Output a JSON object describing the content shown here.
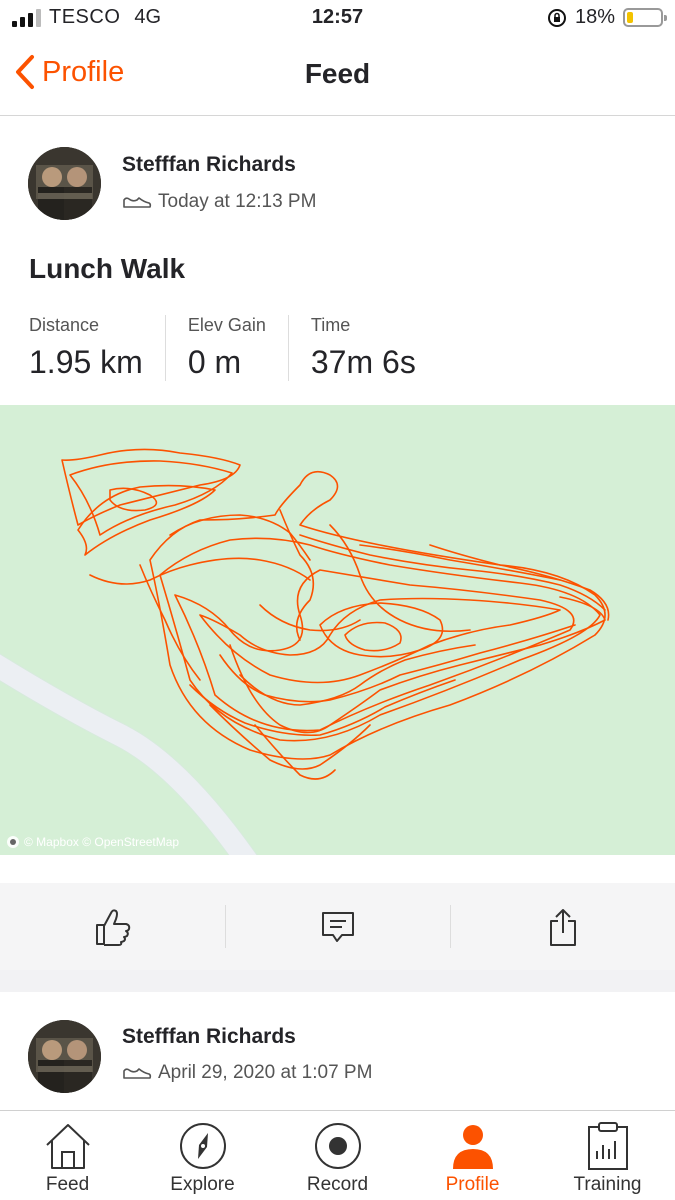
{
  "status_bar": {
    "carrier": "TESCO",
    "network": "4G",
    "time": "12:57",
    "battery": "18%",
    "battery_level": 0.18
  },
  "nav": {
    "back_label": "Profile",
    "title": "Feed"
  },
  "feed": [
    {
      "athlete": "Stefffan Richards",
      "date": "Today at 12:13 PM",
      "activity_type_icon": "shoe-icon",
      "title": "Lunch Walk",
      "stats": [
        {
          "label": "Distance",
          "value": "1.95 km"
        },
        {
          "label": "Elev Gain",
          "value": "0 m"
        },
        {
          "label": "Time",
          "value": "37m 6s"
        }
      ],
      "map_attribution": "© Mapbox © OpenStreetMap",
      "route_color": "#fc5200",
      "actions": [
        "thumbs-up-icon",
        "comment-icon",
        "share-icon"
      ]
    },
    {
      "athlete": "Stefffan Richards",
      "date": "April 29, 2020 at 1:07 PM",
      "activity_type_icon": "shoe-icon"
    }
  ],
  "tabs": [
    {
      "label": "Feed",
      "icon": "house-icon",
      "active": false
    },
    {
      "label": "Explore",
      "icon": "compass-icon",
      "active": false
    },
    {
      "label": "Record",
      "icon": "record-icon",
      "active": false
    },
    {
      "label": "Profile",
      "icon": "person-icon",
      "active": true
    },
    {
      "label": "Training",
      "icon": "clipboard-chart-icon",
      "active": false
    }
  ],
  "colors": {
    "accent": "#fc5200",
    "map_background": "#d5efd6"
  }
}
